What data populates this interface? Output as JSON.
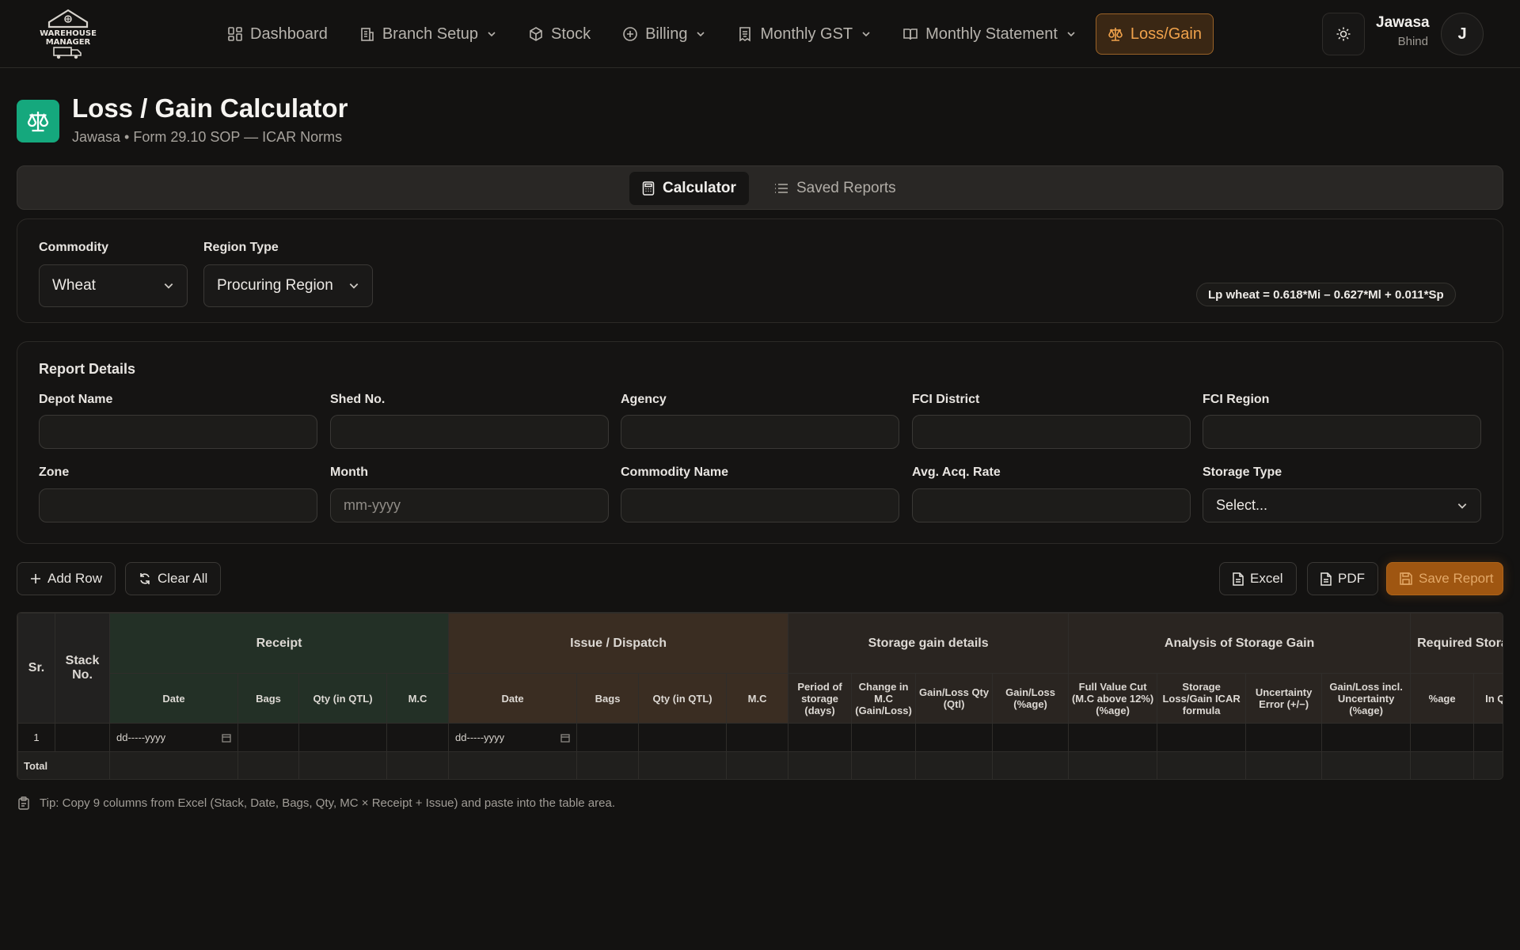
{
  "nav": {
    "logo_text": "WAREHOUSE MANAGER",
    "items": [
      {
        "label": "Dashboard",
        "icon": "dashboard-icon"
      },
      {
        "label": "Branch Setup",
        "icon": "building-icon"
      },
      {
        "label": "Stock",
        "icon": "box-icon"
      },
      {
        "label": "Billing",
        "icon": "plus-circle-icon"
      },
      {
        "label": "Monthly GST",
        "icon": "receipt-icon"
      },
      {
        "label": "Monthly Statement",
        "icon": "book-icon"
      },
      {
        "label": "Loss/Gain",
        "icon": "scale-icon"
      }
    ],
    "active_color": "#f0a24b"
  },
  "user": {
    "name": "Jawasa",
    "location": "Bhind",
    "initial": "J"
  },
  "page": {
    "title": "Loss / Gain Calculator",
    "subtitle": "Jawasa • Form 29.10 SOP — ICAR Norms",
    "accent": "#15a87d"
  },
  "tabs": {
    "calculator": "Calculator",
    "saved": "Saved Reports"
  },
  "filters": {
    "commodity_label": "Commodity",
    "commodity_value": "Wheat",
    "region_label": "Region Type",
    "region_value": "Procuring Region",
    "formula": "Lp wheat = 0.618*Mi – 0.627*Ml + 0.011*Sp"
  },
  "report": {
    "heading": "Report Details",
    "fields": {
      "depot": "Depot Name",
      "shed": "Shed No.",
      "agency": "Agency",
      "district": "FCI District",
      "region": "FCI Region",
      "zone": "Zone",
      "month": "Month",
      "month_placeholder": "mm-yyyy",
      "commodity_name": "Commodity Name",
      "acq_rate": "Avg. Acq. Rate",
      "storage_type": "Storage Type",
      "storage_type_value": "Select..."
    }
  },
  "actions": {
    "add_row": "Add Row",
    "clear_all": "Clear All",
    "excel": "Excel",
    "pdf": "PDF",
    "save": "Save Report"
  },
  "table": {
    "sr": "Sr.",
    "stack": "Stack No.",
    "groups": {
      "receipt": "Receipt",
      "issue": "Issue / Dispatch",
      "storage": "Storage gain details",
      "analysis": "Analysis of Storage Gain",
      "required": "Required Stora"
    },
    "cols": {
      "date": "Date",
      "bags": "Bags",
      "qty": "Qty (in QTL)",
      "mc": "M.C",
      "period": "Period of storage (days)",
      "change_mc": "Change in M.C (Gain/Loss)",
      "gl_qty": "Gain/Loss Qty (Qtl)",
      "gl_pct": "Gain/Loss (%age)",
      "full_cut": "Full Value Cut (M.C above 12%) (%age)",
      "icar": "Storage Loss/Gain ICAR formula",
      "uncert": "Uncertainty Error (+/−)",
      "gl_uncert": "Gain/Loss incl. Uncertainty (%age)",
      "pct": "%age",
      "inq": "In Q"
    },
    "row_sr": "1",
    "date_placeholder": "dd-----yyyy",
    "total": "Total"
  },
  "tip": "Tip: Copy 9 columns from Excel (Stack, Date, Bags, Qty, MC × Receipt + Issue) and paste into the table area."
}
